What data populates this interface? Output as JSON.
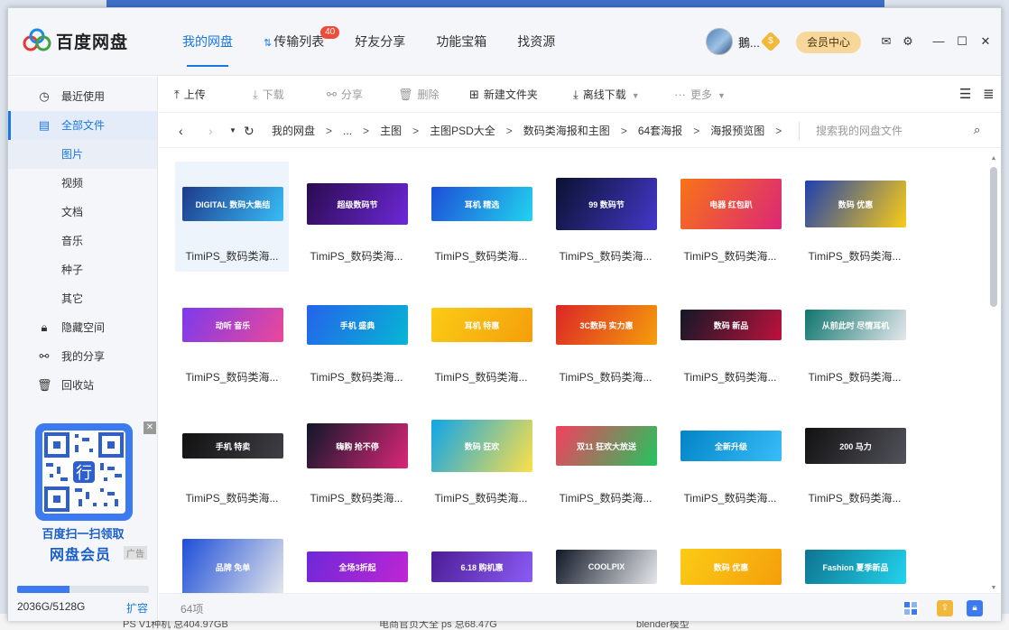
{
  "app": {
    "name": "百度网盘"
  },
  "nav": {
    "tabs": [
      {
        "label": "我的网盘",
        "active": true
      },
      {
        "label": "传输列表",
        "badge": "40"
      },
      {
        "label": "好友分享"
      },
      {
        "label": "功能宝箱"
      },
      {
        "label": "找资源"
      }
    ]
  },
  "user": {
    "name": "鵝...",
    "vip_symbol": "$",
    "member_button": "会员中心"
  },
  "window_controls": [
    "mail-icon",
    "settings-icon",
    "minimize-icon",
    "maximize-icon",
    "close-icon"
  ],
  "sidebar": {
    "items": [
      {
        "label": "最近使用",
        "icon": "clock-icon"
      },
      {
        "label": "全部文件",
        "icon": "file-icon",
        "active": true
      },
      {
        "label": "图片",
        "sub": true,
        "active": true
      },
      {
        "label": "视频",
        "sub": true
      },
      {
        "label": "文档",
        "sub": true
      },
      {
        "label": "音乐",
        "sub": true
      },
      {
        "label": "种子",
        "sub": true
      },
      {
        "label": "其它",
        "sub": true
      },
      {
        "label": "隐藏空间",
        "icon": "lock-icon"
      },
      {
        "label": "我的分享",
        "icon": "share-icon"
      },
      {
        "label": "回收站",
        "icon": "trash-icon"
      }
    ],
    "promo": {
      "line1": "百度扫一扫领取",
      "line2": "网盘会员",
      "ad": "广告",
      "qr_center": " cartoon"
    },
    "storage": {
      "text": "2036G/5128G",
      "used_fraction": 0.397,
      "expand": "扩容"
    }
  },
  "toolbar": {
    "upload": "上传",
    "download": "下载",
    "share": "分享",
    "delete": "删除",
    "new_folder": "新建文件夹",
    "offline_download": "离线下载",
    "more": "更多"
  },
  "address": {
    "crumbs": [
      "我的网盘",
      "...",
      "主图",
      "主图PSD大全",
      "数码类海报和主图",
      "64套海报",
      "海报预览图"
    ],
    "search_placeholder": "搜索我的网盘文件"
  },
  "files": {
    "name": "TimiPS_数码类海...",
    "items": [
      {
        "t": "DIGITAL 数码大集结",
        "c1": "#1e3a8a",
        "c2": "#38bdf8",
        "h": 38
      },
      {
        "t": "超级数码节",
        "c1": "#2a0b4f",
        "c2": "#6d28d9",
        "h": 46
      },
      {
        "t": "耳机 精选",
        "c1": "#1d4ed8",
        "c2": "#22d3ee",
        "h": 38
      },
      {
        "t": "99 数码节",
        "c1": "#0b1130",
        "c2": "#4338ca",
        "h": 58
      },
      {
        "t": "电器 红包趴",
        "c1": "#f97316",
        "c2": "#db2777",
        "h": 56
      },
      {
        "t": "数码 优惠",
        "c1": "#1e40af",
        "c2": "#facc15",
        "h": 52
      },
      {
        "t": "动听 音乐",
        "c1": "#7c3aed",
        "c2": "#ec4899",
        "h": 38
      },
      {
        "t": "手机 盛典",
        "c1": "#2563eb",
        "c2": "#06b6d4",
        "h": 44
      },
      {
        "t": "耳机 特惠",
        "c1": "#facc15",
        "c2": "#f59e0b",
        "h": 38
      },
      {
        "t": "3C数码 实力惠",
        "c1": "#dc2626",
        "c2": "#f59e0b",
        "h": 44
      },
      {
        "t": "数码 新品",
        "c1": "#111827",
        "c2": "#be123c",
        "h": 34
      },
      {
        "t": "从前此时 尽情耳机",
        "c1": "#0f766e",
        "c2": "#e5e7eb",
        "h": 34
      },
      {
        "t": "手机 特卖",
        "c1": "#111111",
        "c2": "#3f3f46",
        "h": 28
      },
      {
        "t": "嗨购 抢不停",
        "c1": "#0f172a",
        "c2": "#db2777",
        "h": 50
      },
      {
        "t": "数码 狂欢",
        "c1": "#0ea5e9",
        "c2": "#fde047",
        "h": 58
      },
      {
        "t": "双11 狂欢大放送",
        "c1": "#f43f5e",
        "c2": "#22c55e",
        "h": 44
      },
      {
        "t": "全新升级",
        "c1": "#0284c7",
        "c2": "#38bdf8",
        "h": 34
      },
      {
        "t": "200 马力",
        "c1": "#111111",
        "c2": "#52525b",
        "h": 40
      },
      {
        "t": "品牌 免单",
        "c1": "#1d4ed8",
        "c2": "#e5e7eb",
        "h": 62
      },
      {
        "t": "全场3折起",
        "c1": "#6d28d9",
        "c2": "#c026d3",
        "h": 34
      },
      {
        "t": "6.18 购机惠",
        "c1": "#4c1d95",
        "c2": "#8b5cf6",
        "h": 34
      },
      {
        "t": "COOLPIX",
        "c1": "#111827",
        "c2": "#e5e7eb",
        "h": 38
      },
      {
        "t": "数码 优惠",
        "c1": "#facc15",
        "c2": "#f59e0b",
        "h": 40
      },
      {
        "t": "Fashion 夏季新品",
        "c1": "#0e7490",
        "c2": "#22d3ee",
        "h": 38
      }
    ]
  },
  "status": {
    "count": "64项"
  },
  "background": {
    "bottom_texts": [
      "PS V1种机 总404.97GB",
      "电商官页大全 ps 总68.47G",
      "blender模型"
    ]
  }
}
